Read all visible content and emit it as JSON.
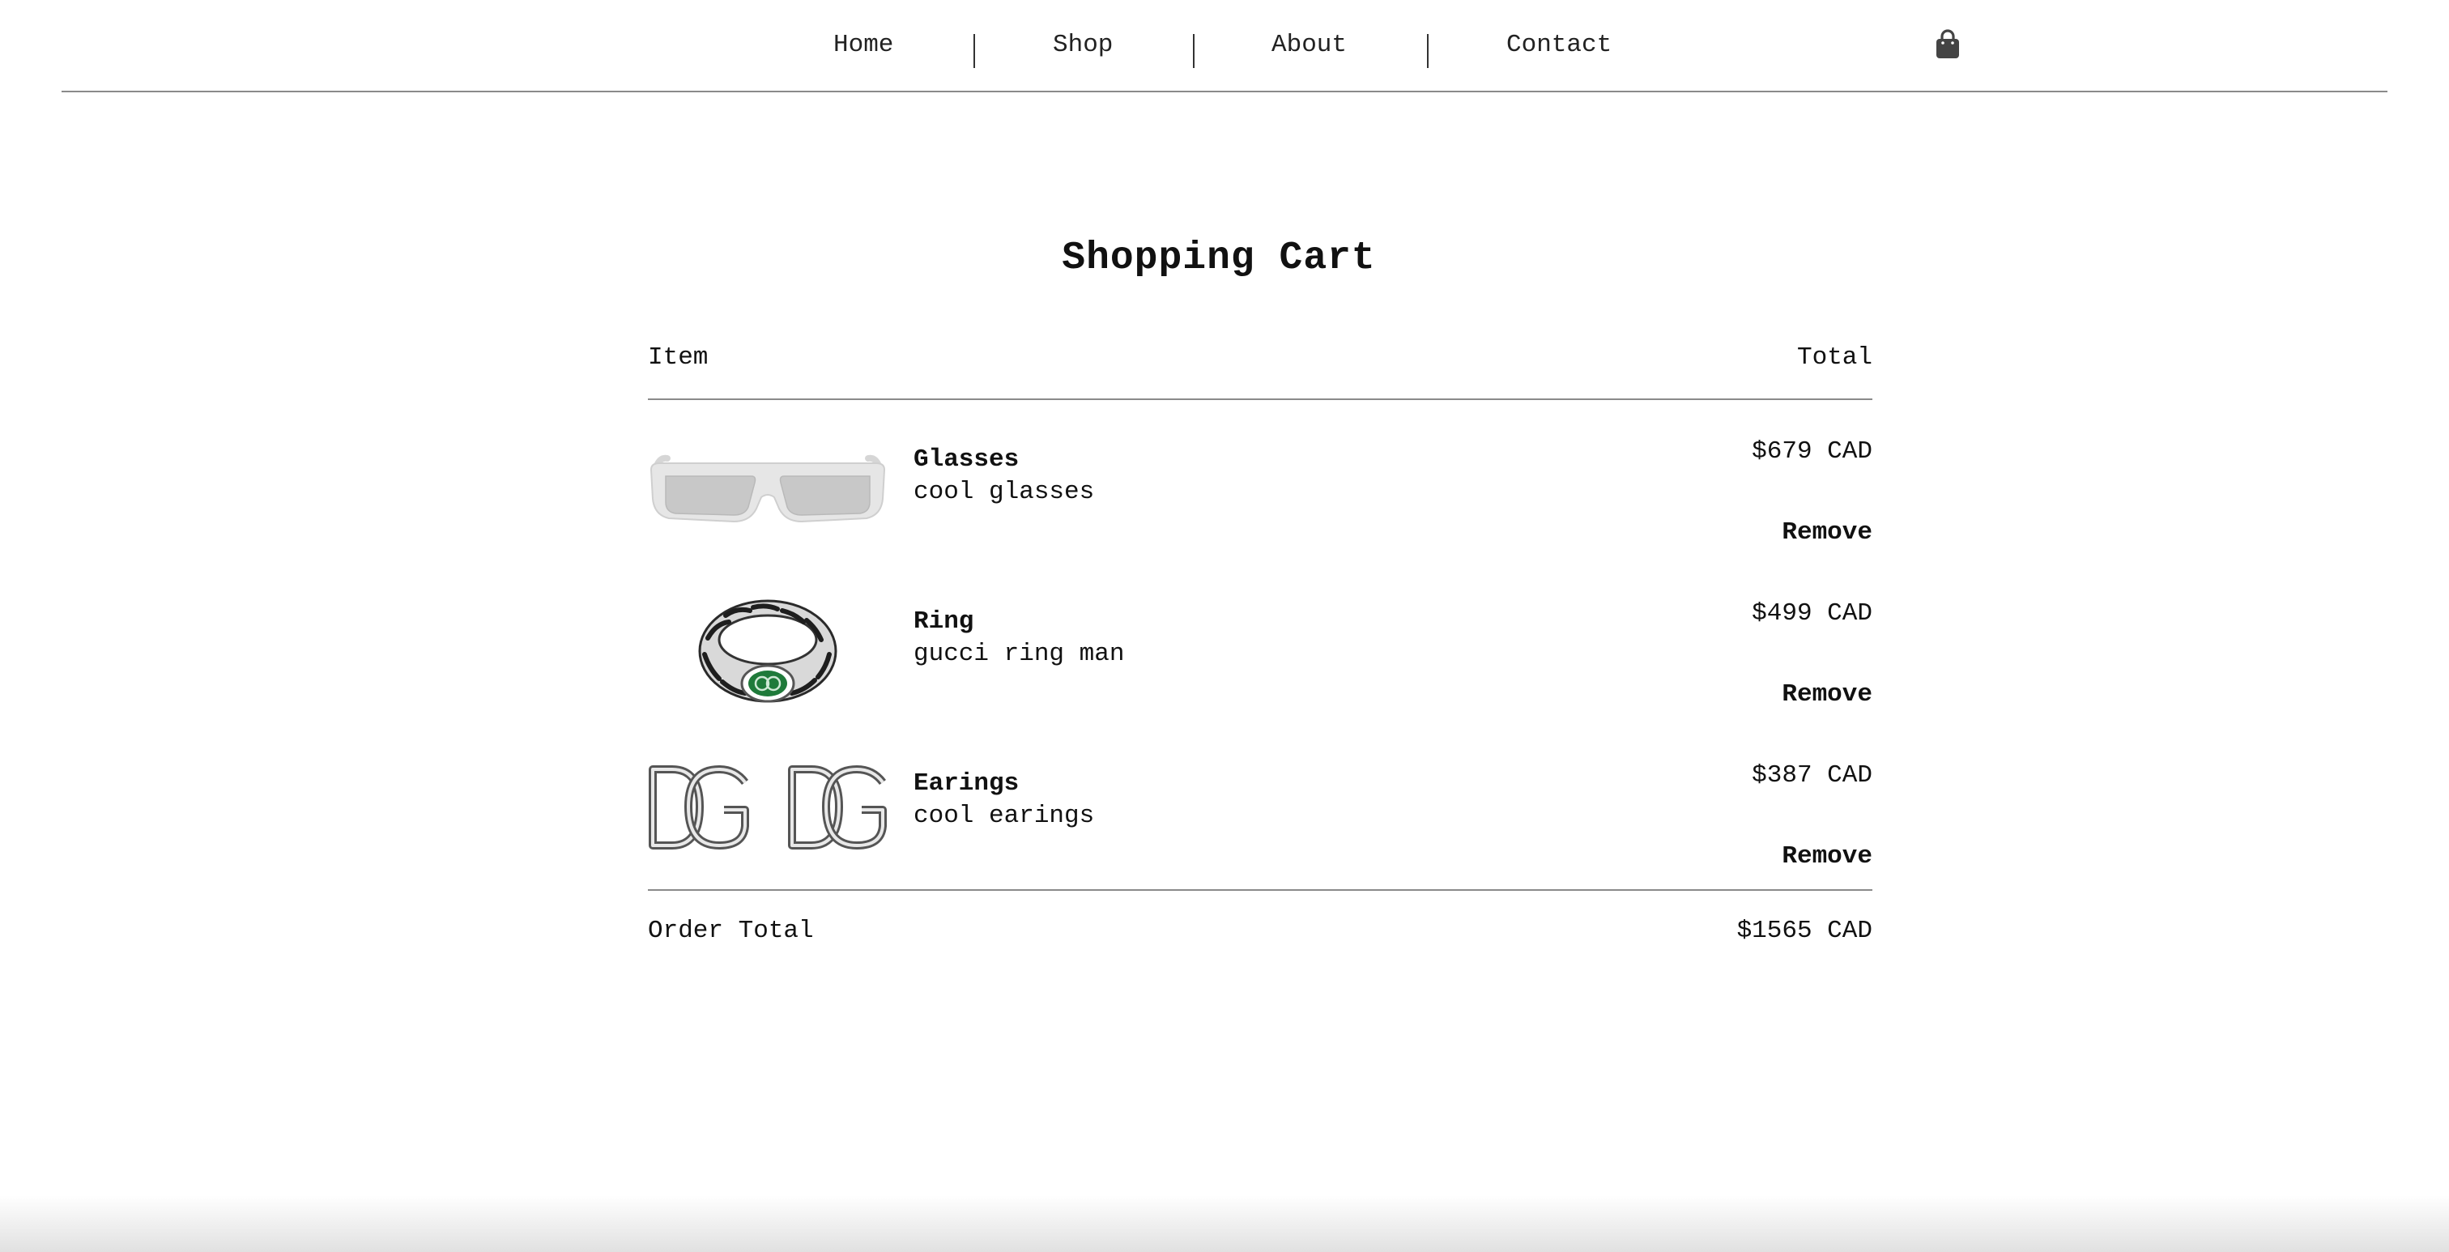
{
  "nav": {
    "links": [
      "Home",
      "Shop",
      "About",
      "Contact"
    ],
    "cart_icon": "shopping-bag-icon"
  },
  "cart": {
    "title": "Shopping Cart",
    "header": {
      "item": "Item",
      "total": "Total"
    },
    "items": [
      {
        "name": "Glasses",
        "description": "cool glasses",
        "price": "$679 CAD",
        "remove_label": "Remove",
        "image": "glasses-image"
      },
      {
        "name": "Ring",
        "description": "gucci ring man",
        "price": "$499 CAD",
        "remove_label": "Remove",
        "image": "ring-image"
      },
      {
        "name": "Earings",
        "description": "cool earings",
        "price": "$387 CAD",
        "remove_label": "Remove",
        "image": "earrings-image"
      }
    ],
    "order_total_label": "Order Total",
    "order_total_value": "$1565 CAD"
  },
  "colors": {
    "text": "#111111",
    "rule": "#8a8a8a",
    "ring_accent": "#1f7a3a"
  }
}
